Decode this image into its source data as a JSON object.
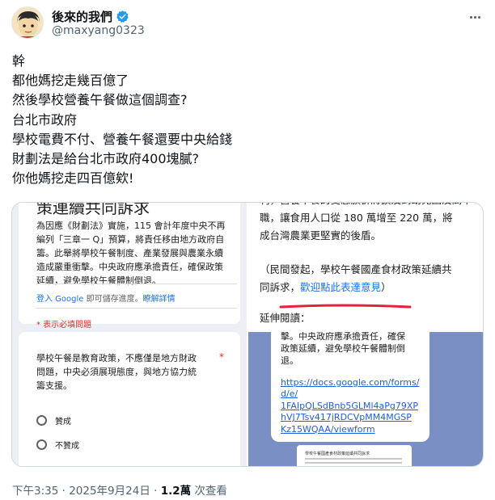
{
  "author": {
    "display_name": "後來的我們",
    "handle": "@maxyang0323",
    "avatar_icon": "cartoon-face-avatar",
    "verified_icon": "verified-badge-icon",
    "verified_color": "#1d9bf0"
  },
  "tweet": {
    "lines": [
      "幹",
      "都他媽挖走幾百億了",
      "然後學校營養午餐做這個調查?",
      "台北市政府",
      "學校電費不付、營養午餐還要中央給錢",
      "財劃法是給台北市政府400塊膩?",
      "你他媽挖走四百億欸!"
    ]
  },
  "media": {
    "left": {
      "cut_title": "策連續共同訴求",
      "intro_lines": [
        "為因應《財劃法》實施，115 會計年度中央不再",
        "編列「三章一 Q」預算，將責任移由地方政府自",
        "籌。此舉將學校午餐制度、產業發展與農業永續",
        "造成嚴重衝擊。中央政府應承擔責任，確保政策",
        "延續，避免學校午餐體制倒退。"
      ],
      "login_link": "登入 Google",
      "login_rest": " 即可儲存進度。",
      "learn_more": "瞭解詳情",
      "required_note": "* 表示必填問題",
      "question_lines": [
        "學校午餐是教育政策，不應僅是地方財政",
        "問題，中央必須展現態度，與地方協力統",
        "籌支援。"
      ],
      "required_star": "*",
      "options": [
        "贊成",
        "不贊成"
      ]
    },
    "right": {
      "top_lines": [
        "職，讓食用人口從 180 萬增至 220 萬，將",
        "成台灣農業更堅實的後盾。"
      ],
      "cut_line": "利，營養午餐的受惠族群將擴及到幼兒園及高中",
      "petition_line1": "（民間發起，學校午餐國產食材政策延續共",
      "petition_prefix": "同訴求，",
      "petition_link": "歡迎點此表達意見",
      "petition_suffix": "）",
      "further_reading": "延伸閱讀：",
      "underline_color": "#e8203a",
      "bubble_lines": [
        "擊。中央政府應承擔責任，確保",
        "政策延續，避免學校午餐體制倒",
        "退。"
      ],
      "bubble_url_lines": [
        "https://docs.google.com/forms/",
        "d/e/",
        "1FAIpQLSdBnb5GLMl4aPg79XP",
        "hVJ7Tsv417jRDCVpMM4MGSP",
        "Kz15WQAA/viewform"
      ],
      "preview_title": "學校午餐國產食材政策延續共同訴求"
    }
  },
  "meta": {
    "time": "下午3:35",
    "date": "2025年9月24日",
    "views_count": "1.2萬",
    "views_label": "次查看",
    "separator": " · "
  }
}
